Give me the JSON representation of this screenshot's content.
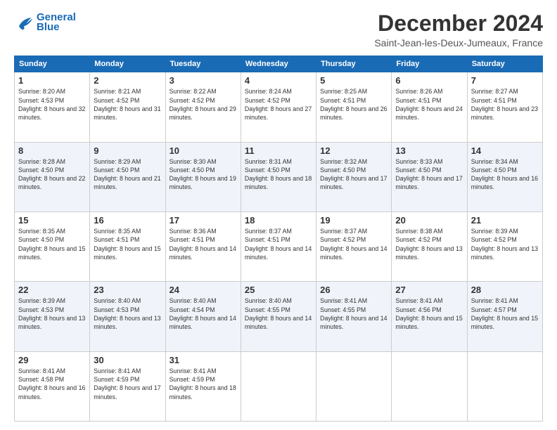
{
  "logo": {
    "line1": "General",
    "line2": "Blue"
  },
  "header": {
    "month": "December 2024",
    "location": "Saint-Jean-les-Deux-Jumeaux, France"
  },
  "weekdays": [
    "Sunday",
    "Monday",
    "Tuesday",
    "Wednesday",
    "Thursday",
    "Friday",
    "Saturday"
  ],
  "weeks": [
    [
      {
        "day": "1",
        "sunrise": "8:20 AM",
        "sunset": "4:53 PM",
        "daylight": "8 hours and 32 minutes."
      },
      {
        "day": "2",
        "sunrise": "8:21 AM",
        "sunset": "4:52 PM",
        "daylight": "8 hours and 31 minutes."
      },
      {
        "day": "3",
        "sunrise": "8:22 AM",
        "sunset": "4:52 PM",
        "daylight": "8 hours and 29 minutes."
      },
      {
        "day": "4",
        "sunrise": "8:24 AM",
        "sunset": "4:52 PM",
        "daylight": "8 hours and 27 minutes."
      },
      {
        "day": "5",
        "sunrise": "8:25 AM",
        "sunset": "4:51 PM",
        "daylight": "8 hours and 26 minutes."
      },
      {
        "day": "6",
        "sunrise": "8:26 AM",
        "sunset": "4:51 PM",
        "daylight": "8 hours and 24 minutes."
      },
      {
        "day": "7",
        "sunrise": "8:27 AM",
        "sunset": "4:51 PM",
        "daylight": "8 hours and 23 minutes."
      }
    ],
    [
      {
        "day": "8",
        "sunrise": "8:28 AM",
        "sunset": "4:50 PM",
        "daylight": "8 hours and 22 minutes."
      },
      {
        "day": "9",
        "sunrise": "8:29 AM",
        "sunset": "4:50 PM",
        "daylight": "8 hours and 21 minutes."
      },
      {
        "day": "10",
        "sunrise": "8:30 AM",
        "sunset": "4:50 PM",
        "daylight": "8 hours and 19 minutes."
      },
      {
        "day": "11",
        "sunrise": "8:31 AM",
        "sunset": "4:50 PM",
        "daylight": "8 hours and 18 minutes."
      },
      {
        "day": "12",
        "sunrise": "8:32 AM",
        "sunset": "4:50 PM",
        "daylight": "8 hours and 17 minutes."
      },
      {
        "day": "13",
        "sunrise": "8:33 AM",
        "sunset": "4:50 PM",
        "daylight": "8 hours and 17 minutes."
      },
      {
        "day": "14",
        "sunrise": "8:34 AM",
        "sunset": "4:50 PM",
        "daylight": "8 hours and 16 minutes."
      }
    ],
    [
      {
        "day": "15",
        "sunrise": "8:35 AM",
        "sunset": "4:50 PM",
        "daylight": "8 hours and 15 minutes."
      },
      {
        "day": "16",
        "sunrise": "8:35 AM",
        "sunset": "4:51 PM",
        "daylight": "8 hours and 15 minutes."
      },
      {
        "day": "17",
        "sunrise": "8:36 AM",
        "sunset": "4:51 PM",
        "daylight": "8 hours and 14 minutes."
      },
      {
        "day": "18",
        "sunrise": "8:37 AM",
        "sunset": "4:51 PM",
        "daylight": "8 hours and 14 minutes."
      },
      {
        "day": "19",
        "sunrise": "8:37 AM",
        "sunset": "4:52 PM",
        "daylight": "8 hours and 14 minutes."
      },
      {
        "day": "20",
        "sunrise": "8:38 AM",
        "sunset": "4:52 PM",
        "daylight": "8 hours and 13 minutes."
      },
      {
        "day": "21",
        "sunrise": "8:39 AM",
        "sunset": "4:52 PM",
        "daylight": "8 hours and 13 minutes."
      }
    ],
    [
      {
        "day": "22",
        "sunrise": "8:39 AM",
        "sunset": "4:53 PM",
        "daylight": "8 hours and 13 minutes."
      },
      {
        "day": "23",
        "sunrise": "8:40 AM",
        "sunset": "4:53 PM",
        "daylight": "8 hours and 13 minutes."
      },
      {
        "day": "24",
        "sunrise": "8:40 AM",
        "sunset": "4:54 PM",
        "daylight": "8 hours and 14 minutes."
      },
      {
        "day": "25",
        "sunrise": "8:40 AM",
        "sunset": "4:55 PM",
        "daylight": "8 hours and 14 minutes."
      },
      {
        "day": "26",
        "sunrise": "8:41 AM",
        "sunset": "4:55 PM",
        "daylight": "8 hours and 14 minutes."
      },
      {
        "day": "27",
        "sunrise": "8:41 AM",
        "sunset": "4:56 PM",
        "daylight": "8 hours and 15 minutes."
      },
      {
        "day": "28",
        "sunrise": "8:41 AM",
        "sunset": "4:57 PM",
        "daylight": "8 hours and 15 minutes."
      }
    ],
    [
      {
        "day": "29",
        "sunrise": "8:41 AM",
        "sunset": "4:58 PM",
        "daylight": "8 hours and 16 minutes."
      },
      {
        "day": "30",
        "sunrise": "8:41 AM",
        "sunset": "4:59 PM",
        "daylight": "8 hours and 17 minutes."
      },
      {
        "day": "31",
        "sunrise": "8:41 AM",
        "sunset": "4:59 PM",
        "daylight": "8 hours and 18 minutes."
      },
      null,
      null,
      null,
      null
    ]
  ],
  "labels": {
    "sunrise": "Sunrise: ",
    "sunset": "Sunset: ",
    "daylight": "Daylight: "
  }
}
